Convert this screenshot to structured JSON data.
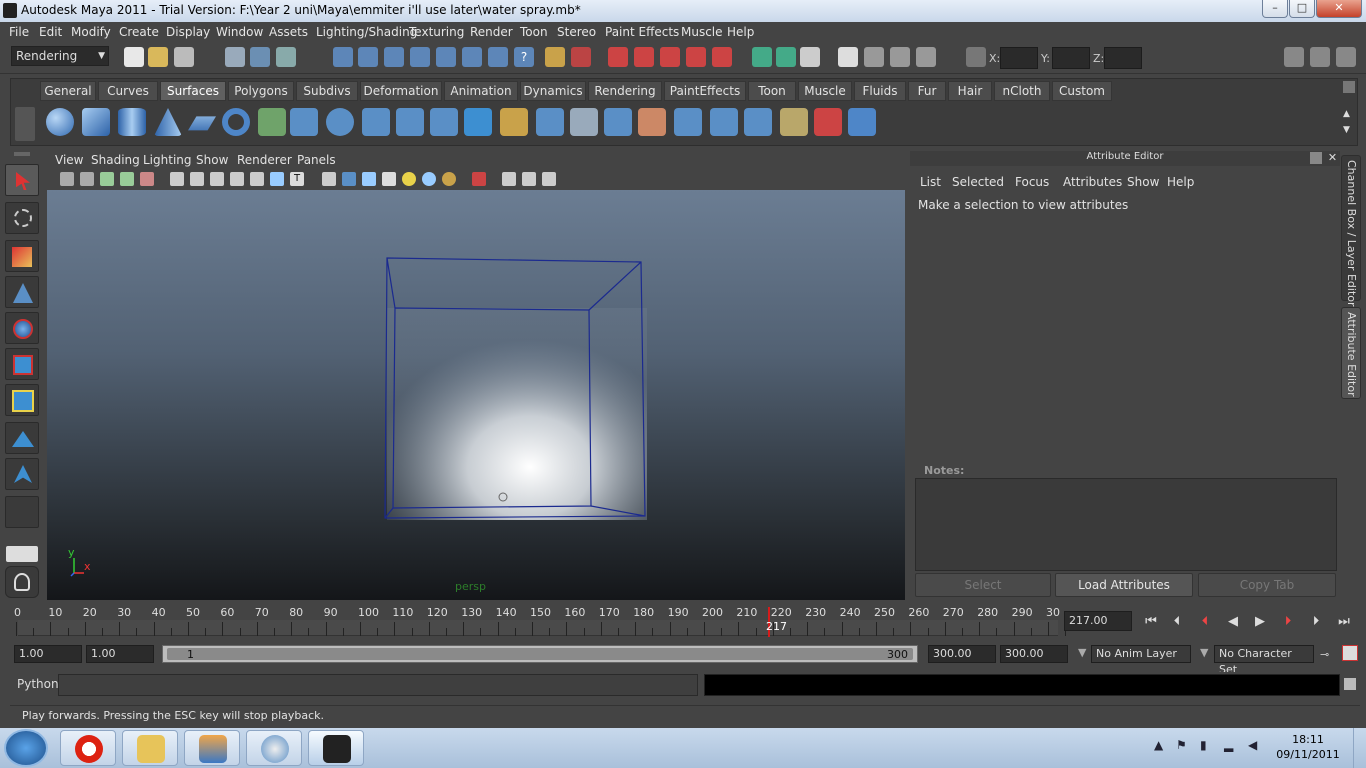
{
  "window": {
    "title": "Autodesk Maya 2011 - Trial Version: F:\\Year 2 uni\\Maya\\emmiter i'll use later\\water spray.mb*",
    "minimize": "–",
    "maximize": "□",
    "close": "✕"
  },
  "menubar": [
    "File",
    "Edit",
    "Modify",
    "Create",
    "Display",
    "Window",
    "Assets",
    "Lighting/Shading",
    "Texturing",
    "Render",
    "Toon",
    "Stereo",
    "Paint Effects",
    "Muscle",
    "Help"
  ],
  "status": {
    "menuset": "Rendering",
    "x_label": "X:",
    "y_label": "Y:",
    "z_label": "Z:"
  },
  "shelf": {
    "tabs": [
      "General",
      "Curves",
      "Surfaces",
      "Polygons",
      "Subdivs",
      "Deformation",
      "Animation",
      "Dynamics",
      "Rendering",
      "PaintEffects",
      "Toon",
      "Muscle",
      "Fluids",
      "Fur",
      "Hair",
      "nCloth",
      "Custom"
    ],
    "active_tab": "Surfaces"
  },
  "viewport": {
    "menu": [
      "View",
      "Shading",
      "Lighting",
      "Show",
      "Renderer",
      "Panels"
    ],
    "camera": "persp",
    "axis_y": "y",
    "axis_x": "x"
  },
  "attribute_editor": {
    "title": "Attribute Editor",
    "menu": [
      "List",
      "Selected",
      "Focus",
      "Attributes",
      "Show",
      "Help"
    ],
    "message": "Make a selection to view attributes",
    "notes_label": "Notes:",
    "buttons": {
      "select": "Select",
      "load": "Load Attributes",
      "copy": "Copy Tab"
    }
  },
  "side_tabs": {
    "channel_box": "Channel Box / Layer Editor",
    "attribute_editor": "Attribute Editor"
  },
  "timeline": {
    "ticks": [
      "0",
      "10",
      "20",
      "30",
      "40",
      "50",
      "60",
      "70",
      "80",
      "90",
      "100",
      "110",
      "120",
      "130",
      "140",
      "150",
      "160",
      "170",
      "180",
      "190",
      "200",
      "210",
      "220",
      "230",
      "240",
      "250",
      "260",
      "270",
      "280",
      "290",
      "30"
    ],
    "current_frame": "217",
    "current_frame_field": "217.00"
  },
  "range": {
    "start": "1.00",
    "anim_start": "1.00",
    "slider_start": "1",
    "slider_end": "300",
    "anim_end": "300.00",
    "end": "300.00",
    "anim_layer": "No Anim Layer",
    "character_set": "No Character Set"
  },
  "command": {
    "lang": "Python"
  },
  "help": {
    "text": "Play forwards. Pressing the ESC key will stop playback."
  },
  "taskbar": {
    "time": "18:11",
    "date": "09/11/2011"
  }
}
